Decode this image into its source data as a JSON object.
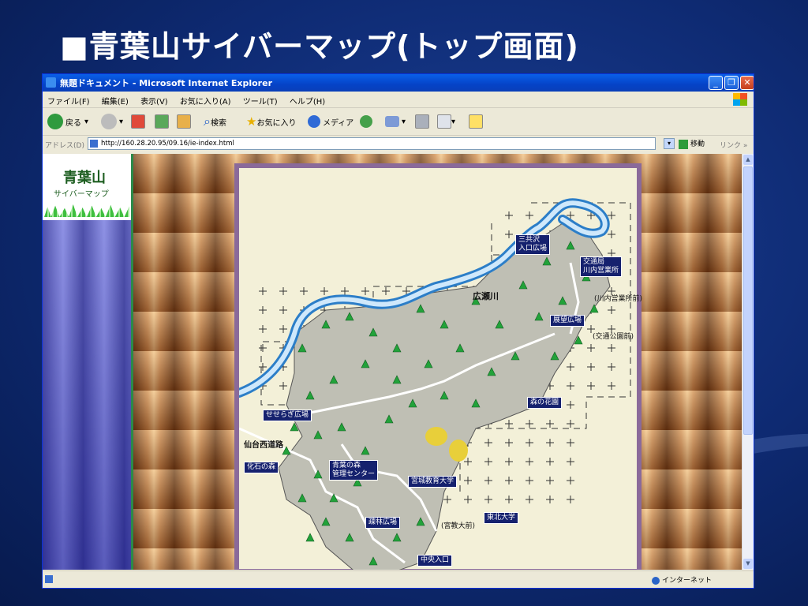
{
  "slide": {
    "title": "■青葉山サイバーマップ(トップ画面)"
  },
  "window": {
    "title": "無題ドキュメント - Microsoft Internet Explorer"
  },
  "menu": [
    "ファイル(F)",
    "編集(E)",
    "表示(V)",
    "お気に入り(A)",
    "ツール(T)",
    "ヘルプ(H)"
  ],
  "toolbar": {
    "back": "戻る",
    "search": "検索",
    "favorites": "お気に入り",
    "media": "メディア"
  },
  "address": {
    "label": "アドレス(D)",
    "url": "http://160.28.20.95/09.16/ie-index.html",
    "go": "移動",
    "links": "リンク"
  },
  "status": {
    "zone": "インターネット"
  },
  "left": {
    "title": "青葉山",
    "subtitle": "サイバーマップ"
  },
  "map": {
    "river": "広瀬川",
    "labels": {
      "sansawa": "三共沢\n入口広場",
      "kotsu": "交通局\n川内営業所",
      "kawauchi_note": "(川内営業所前)",
      "tenbo": "展望広場",
      "kotsu_park": "(交通公園前)",
      "seseragi": "せせらぎ広場",
      "sendai_west": "仙台西道路",
      "kaseki": "化石の森",
      "aoba_center": "青葉の森\n管理センター",
      "mori_kaen": "森の花園",
      "miyagi_edu": "宮城教育大学",
      "shorin": "疎林広場",
      "tohoku": "東北大学",
      "miyakyo_note": "(宮教大前)",
      "chuo": "中央入口"
    }
  }
}
